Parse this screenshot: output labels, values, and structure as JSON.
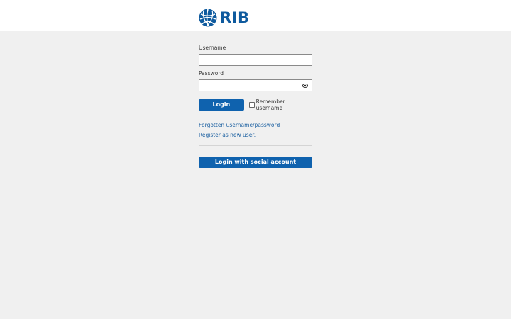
{
  "header": {
    "logo_text": "RIB",
    "brand_color": "#0e5a9e"
  },
  "form": {
    "username_label": "Username",
    "username_value": "",
    "password_label": "Password",
    "password_value": "",
    "show_password_icon": "eye-icon",
    "login_button": "Login",
    "remember_label": "Remember username",
    "remember_checked": false,
    "forgot_link": "Forgotten username/password",
    "register_link": "Register as new user.",
    "social_button": "Login with social account"
  },
  "colors": {
    "button": "#0f62ae",
    "link": "#1a5fa0",
    "background": "#f0f0f0"
  }
}
